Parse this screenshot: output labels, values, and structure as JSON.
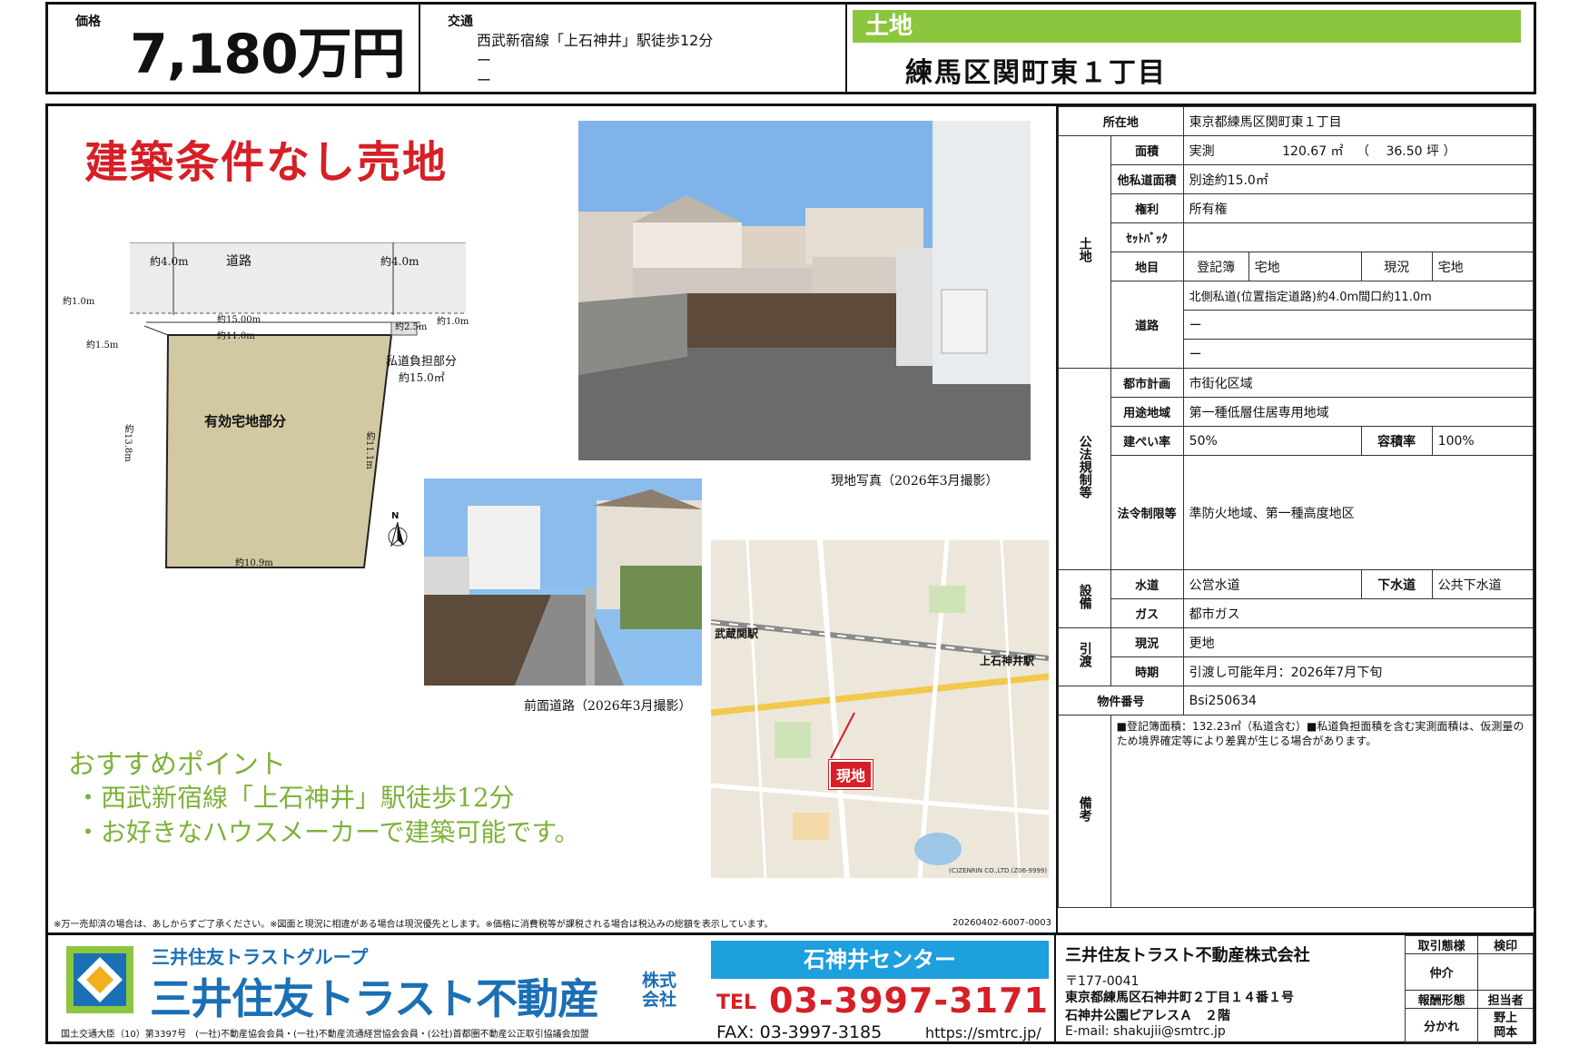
{
  "header": {
    "price_label": "価格",
    "price": "7,180万円",
    "traffic_label": "交通",
    "traffic_line1": "西武新宿線「上石神井」駅徒歩12分",
    "traffic_line2": "ー",
    "traffic_line3": "ー",
    "category": "土地",
    "address_title": "練馬区関町東１丁目"
  },
  "left": {
    "headline": "建築条件なし売地",
    "plan": {
      "road": "道路",
      "road_w_left": "約4.0m",
      "road_w_right": "約4.0m",
      "corner_left": "約1.0m",
      "corner_right": "約1.0m",
      "top_len": "約15.00m",
      "lot_top": "約11.0m",
      "lot_bottom": "約10.9m",
      "left_off": "約1.5m",
      "right_off": "約2.5m",
      "left_side": "約13.8m",
      "right_side": "約11.1m",
      "private_road": "私道負担部分",
      "private_area": "約15.0㎡",
      "lot_label": "有効宅地部分",
      "north": "N"
    },
    "photo1_caption": "現地写真（2026年3月撮影）",
    "photo2_caption": "前面道路（2026年3月撮影）",
    "map": {
      "site_label": "現地",
      "station1": "武蔵関駅",
      "station2": "上石神井駅",
      "credit": "(C)ZENRIN CO.,LTD.(Z06-9999)"
    },
    "points_title": "おすすめポイント",
    "point1": "・西武新宿線「上石神井」駅徒歩12分",
    "point2": "・お好きなハウスメーカーで建築可能です。",
    "disclaimer": "※万一売却済の場合は、あしからずご了承ください。※図面と現況に相違がある場合は現況優先とします。※価格に消費税等が課税される場合は税込みの総額を表示しています。",
    "doc_code": "20260402-6007-0003"
  },
  "spec": {
    "location_k": "所在地",
    "location_v": "東京都練馬区関町東１丁目",
    "group_land": "土地",
    "area_k": "面積",
    "area_v1": "実測",
    "area_v2": "120.67 ㎡",
    "area_v3": "（　 36.50 坪 ）",
    "priv_k": "他私道面積",
    "priv_v": "別途約15.0㎡",
    "right_k": "権利",
    "right_v": "所有権",
    "setback_k": "ｾｯﾄﾊﾞｯｸ",
    "setback_v": "",
    "chimoku_k": "地目",
    "chimoku_reg": "登記簿",
    "chimoku_reg_v": "宅地",
    "chimoku_cur": "現況",
    "chimoku_cur_v": "宅地",
    "road_k": "道路",
    "road_v1": "北側私道(位置指定道路)約4.0m間口約11.0m",
    "road_v2": "ー",
    "road_v3": "ー",
    "group_law": "公法規制等",
    "city_k": "都市計画",
    "city_v": "市街化区域",
    "use_k": "用途地域",
    "use_v": "第一種低層住居専用地域",
    "bcr_k": "建ぺい率",
    "bcr_v": "50%",
    "far_k": "容積率",
    "far_v": "100%",
    "reg_k": "法令制限等",
    "reg_v": "準防火地域、第一種高度地区",
    "group_equip": "設備",
    "water_k": "水道",
    "water_v": "公営水道",
    "sewer_k": "下水道",
    "sewer_v": "公共下水道",
    "gas_k": "ガス",
    "gas_v": "都市ガス",
    "group_deliver": "引渡",
    "cond_k": "現況",
    "cond_v": "更地",
    "time_k": "時期",
    "time_v": "引渡し可能年月：2026年7月下旬",
    "id_k": "物件番号",
    "id_v": "Bsi250634",
    "group_note": "備考",
    "note_v": "■登記簿面積：132.23㎡（私道含む）■私道負担面積を含む実測面積は、仮測量のため境界確定等により差異が生じる場合があります。"
  },
  "footer": {
    "group": "三井住友トラストグループ",
    "company_logo": "三井住友トラスト不動産",
    "kabu": "株式会社",
    "license": "国土交通大臣（10）第3397号　(一社)不動産協会会員・(一社)不動産流通経営協会会員・(公社)首都圏不動産公正取引協議会加盟",
    "center": "石神井センター",
    "tel_label": "TEL",
    "tel": "03-3997-3171",
    "fax": "FAX:  03-3997-3185",
    "url": "https://smtrc.jp/",
    "company_name": "三井住友トラスト不動産株式会社",
    "zip": "〒177-0041",
    "addr1": "東京都練馬区石神井町２丁目１４番１号",
    "addr2": "石神井公園ピアレスＡ　２階",
    "email": "E-mail:  shakujii@smtrc.jp",
    "r1c1": "取引態様",
    "r1c2": "検印",
    "r2c1": "仲介",
    "r3c1": "報酬形態",
    "r3c2": "担当者",
    "r4c1": "分かれ",
    "r4c2a": "野上",
    "r4c2b": "岡本"
  },
  "colors": {
    "green": "#8cc63f",
    "red": "#d61f26",
    "olive": "#7eb23a",
    "blue": "#1b6fb5",
    "lot": "#d2c8a2"
  }
}
